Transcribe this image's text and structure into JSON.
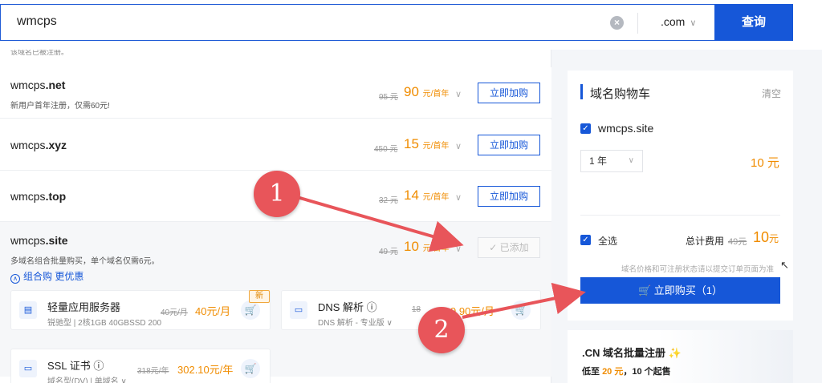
{
  "search": {
    "query": "wmcps",
    "tld": ".com",
    "button_label": "查询"
  },
  "cutoff_text": "该域名已被注册。",
  "domains": [
    {
      "name": "wmcps",
      "tld": ".net",
      "sub": "新用户首年注册，仅需60元!",
      "old_price": "95 元",
      "price": "90",
      "unit": "元/首年",
      "action": "立即加购"
    },
    {
      "name": "wmcps",
      "tld": ".xyz",
      "sub": "",
      "old_price": "450 元",
      "price": "15",
      "unit": "元/首年",
      "action": "立即加购"
    },
    {
      "name": "wmcps",
      "tld": ".top",
      "sub": "",
      "old_price": "32 元",
      "price": "14",
      "unit": "元/首年",
      "action": "立即加购"
    },
    {
      "name": "wmcps",
      "tld": ".site",
      "sub": "多域名组合批量购买，单个域名仅需6元。",
      "old_price": "49 元",
      "price": "10",
      "unit": "元/首年",
      "action": "✓ 已添加"
    }
  ],
  "combo_link": "组合购 更优惠",
  "combo_cards": [
    {
      "title": "轻量应用服务器",
      "sub": "锐驰型 | 2核1GB 40GBSSD 200",
      "old": "40元/月",
      "price": "40元/月",
      "badge": "新",
      "icon": "server-icon"
    },
    {
      "title": "DNS 解析 ⓘ",
      "sub": "DNS 解析 - 专业版 ∨",
      "old": "18",
      "price": "9.90元/月",
      "icon": "dns-icon"
    },
    {
      "title": "SSL 证书 ⓘ",
      "sub": "域名型(DV) | 单域名 ∨",
      "old": "318元/年",
      "price": "302.10元/年",
      "icon": "ssl-icon"
    }
  ],
  "cart": {
    "title": "域名购物车",
    "clear": "清空",
    "item": "wmcps.site",
    "year": "1 年",
    "item_price": "10 元",
    "select_all": "全选",
    "total_label": "总计费用",
    "total_old": "49元",
    "total_new": "10",
    "total_unit": "元",
    "note": "域名价格和可注册状态请以提交订单页面为准",
    "buy_now": "立即购买（1）"
  },
  "promo": {
    "title": ".CN 域名批量注册 ✨",
    "sub_prefix": "低至",
    "sub_highlight": "20 元",
    "sub_suffix": "，10 个起售"
  },
  "annotations": [
    "1",
    "2"
  ],
  "colors": {
    "accent": "#1657d8",
    "price": "#f08c00",
    "annotation": "#e8555a"
  }
}
